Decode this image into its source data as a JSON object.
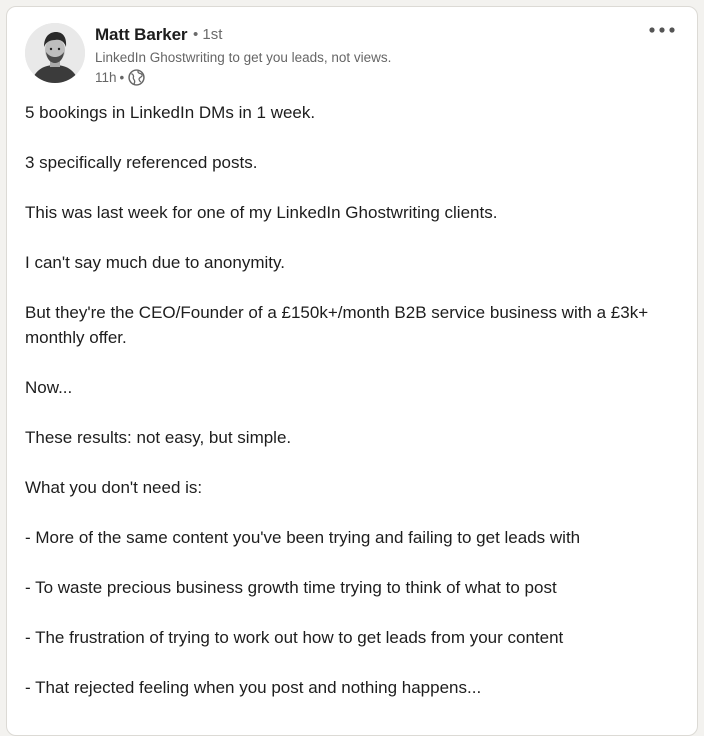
{
  "post": {
    "author": {
      "name": "Matt Barker",
      "degree": "1st",
      "headline": "LinkedIn Ghostwriting to get you leads, not views.",
      "timestamp": "11h",
      "visibility_icon": "globe-icon"
    },
    "menu_icon": "ellipsis-icon",
    "paragraphs": [
      "5 bookings in LinkedIn DMs in 1 week.",
      "3 specifically referenced posts.",
      "This was last week for one of my LinkedIn Ghostwriting clients.",
      "I can't say much due to anonymity.",
      "But they're the CEO/Founder of a £150k+/month B2B service business with a £3k+ monthly offer.",
      "Now...",
      "These results: not easy, but simple.",
      "What you don't need is:",
      "- More of the same content you've been trying and failing to get leads with",
      "- To waste precious business growth time trying to think of what to post",
      "- The frustration of trying to work out how to get leads from your content",
      "- That rejected feeling when you post and nothing happens..."
    ]
  },
  "colors": {
    "background": "#f3f2ef",
    "card": "#ffffff",
    "text": "#1d1d1d",
    "secondary_text": "#666666"
  }
}
